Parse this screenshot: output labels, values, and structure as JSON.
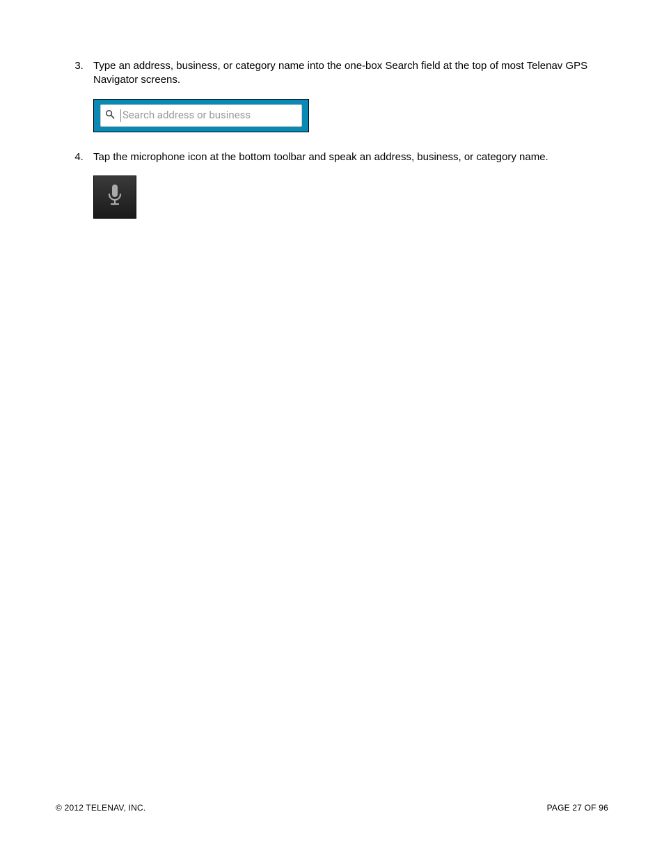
{
  "steps": {
    "start": 3,
    "item3": {
      "text": "Type an address, business, or category name into the one-box Search field at the top of most Telenav GPS Navigator screens.",
      "search_placeholder": "Search address or business"
    },
    "item4": {
      "text": "Tap the microphone icon at the bottom toolbar and speak an address, business, or category name."
    }
  },
  "footer": {
    "copyright": "© 2012 TELENAV, INC.",
    "page": "PAGE 27 OF 96"
  }
}
